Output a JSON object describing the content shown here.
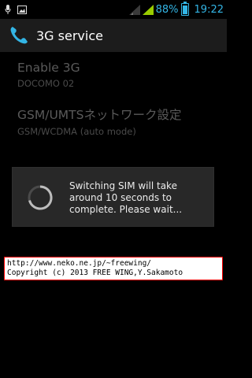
{
  "status_bar": {
    "battery_percent": "88%",
    "time": "19:22",
    "accent_color": "#33b5e5",
    "signal_icon_color": "#99cc00"
  },
  "action_bar": {
    "title": "3G service"
  },
  "preferences": [
    {
      "title": "Enable 3G",
      "summary": "DOCOMO 02"
    },
    {
      "title": "GSM/UMTSネットワーク設定",
      "summary": "GSM/WCDMA (auto mode)"
    }
  ],
  "dialog": {
    "message": "Switching SIM will take around 10 seconds to complete. Please wait..."
  },
  "watermark": {
    "line1": "http://www.neko.ne.jp/~freewing/",
    "line2": "Copyright (c) 2013 FREE WING,Y.Sakamoto"
  }
}
